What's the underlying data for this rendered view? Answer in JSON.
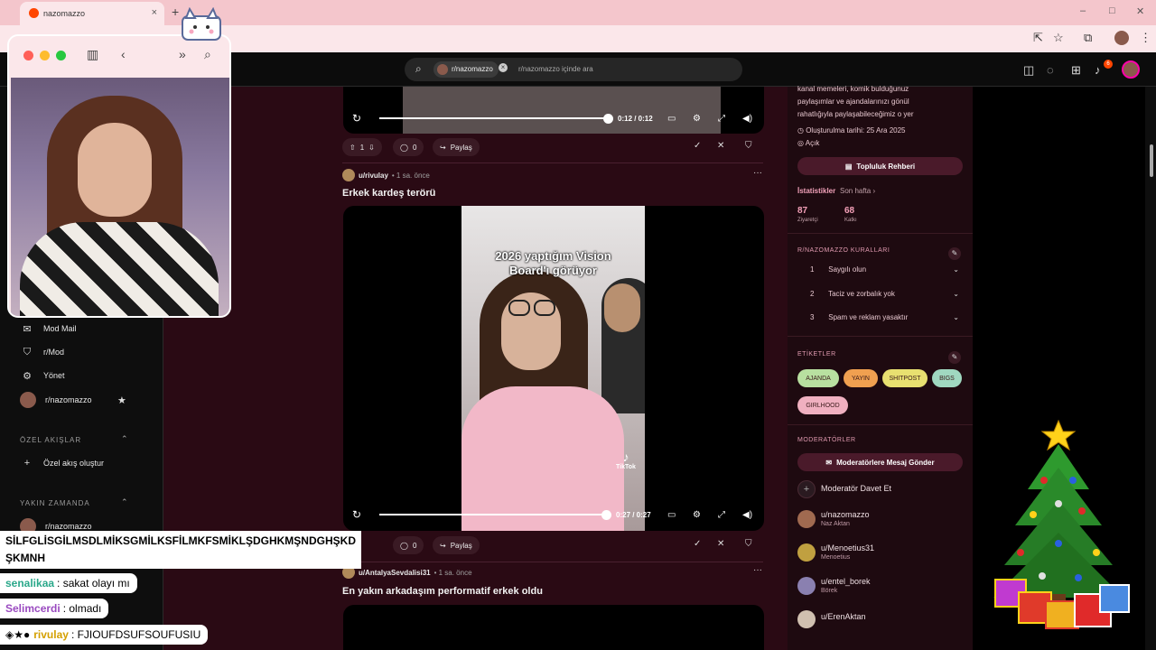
{
  "browser": {
    "tab_title": "nazomazzo",
    "tab_close": "×",
    "new_tab": "+",
    "win_min": "–",
    "win_max": "□",
    "win_close": "✕"
  },
  "header": {
    "search_chip": "r/nazomazzo",
    "search_placeholder": "r/nazomazzo içinde ara",
    "notif_count": "6"
  },
  "left_nav": {
    "items": [
      {
        "label": "Mod Mail"
      },
      {
        "label": "r/Mod"
      },
      {
        "label": "Yönet"
      },
      {
        "label": "r/nazomazzo"
      },
      {
        "label": "Özel akış oluştur"
      },
      {
        "label": "r/nazomazzo"
      }
    ],
    "section_custom": "ÖZEL AKIŞLAR",
    "section_recent": "YAKIN ZAMANDA"
  },
  "feed": {
    "post0": {
      "time_display": "0:12 / 0:12",
      "upvotes": "1",
      "comments": "0",
      "share": "Paylaş"
    },
    "post1": {
      "user": "u/rivulay",
      "time": "• 1 sa. önce",
      "title": "Erkek kardeş terörü",
      "video_caption_line1": "2026 yaptığım Vision",
      "video_caption_line2": "Board'ı görüyor",
      "tiktok_label": "TikTok",
      "time_display": "0:27 / 0:27",
      "progress": 1.0,
      "comments": "0",
      "share": "Paylaş"
    },
    "post2": {
      "user": "u/AntalyaSevdalisi31",
      "time": "• 1 sa. önce",
      "title": "En yakın arkadaşım performatif erkek oldu"
    }
  },
  "right_sidebar": {
    "desc_line1": "kanal memeleri, komik bulduğunuz",
    "desc_line2": "paylaşımlar ve ajandalarınızı gönül",
    "desc_line3": "rahatlığıyla paylaşabileceğimiz o yer",
    "created": "Oluşturulma tarihi: 25 Ara 2025",
    "status": "Açık",
    "guide_button": "Topluluk Rehberi",
    "stats_title": "İstatistikler",
    "stats_range": "Son hafta ›",
    "visits_value": "87",
    "visits_label": "Ziyaretçi",
    "contrib_value": "68",
    "contrib_label": "Katkı",
    "rules_title": "R/NAZOMAZZO KURALLARI",
    "rules": [
      {
        "n": "1",
        "label": "Saygılı olun"
      },
      {
        "n": "2",
        "label": "Taciz ve zorbalık yok"
      },
      {
        "n": "3",
        "label": "Spam ve reklam yasaktır"
      }
    ],
    "tags_title": "ETİKETLER",
    "tags": [
      {
        "label": "AJANDA",
        "color": "#b8e0a0"
      },
      {
        "label": "YAYIN",
        "color": "#f0a050"
      },
      {
        "label": "SHITPOST",
        "color": "#e8e070"
      },
      {
        "label": "BIGS",
        "color": "#a0d8c0"
      },
      {
        "label": "GIRLHOOD",
        "color": "#f0b0c0"
      }
    ],
    "mods_title": "MODERATÖRLER",
    "mods_button": "Moderatörlere Mesaj Gönder",
    "invite_mod": "Moderatör Davet Et",
    "mods": [
      {
        "name": "u/nazomazzo",
        "sub": "Naz Aktan"
      },
      {
        "name": "u/Menoetius31",
        "sub": "Menoetius"
      },
      {
        "name": "u/entel_borek",
        "sub": "Börek"
      },
      {
        "name": "u/ErenAktan",
        "sub": ""
      }
    ]
  },
  "chat": {
    "big_message": "SİLFGLİSGİLMSDLMİKSGMİLKSFİLMKFSMİKLŞDGHKMŞNDGHŞKDŞKMNH",
    "messages": [
      {
        "user": "senalikaa",
        "text": ": sakat olayı mı",
        "color": "#2aa88a"
      },
      {
        "user": "Selimcerdi",
        "text": ": olmadı",
        "color": "#9a4ac0"
      },
      {
        "user": "rivulay",
        "text": ": FJIOUFDSUFSOUFUSIU",
        "color": "#d4a000"
      }
    ]
  },
  "colors": {
    "feed_bg": "#2a0a14",
    "accent": "#ff4500",
    "sidebar_bg": "#1e0a10"
  }
}
